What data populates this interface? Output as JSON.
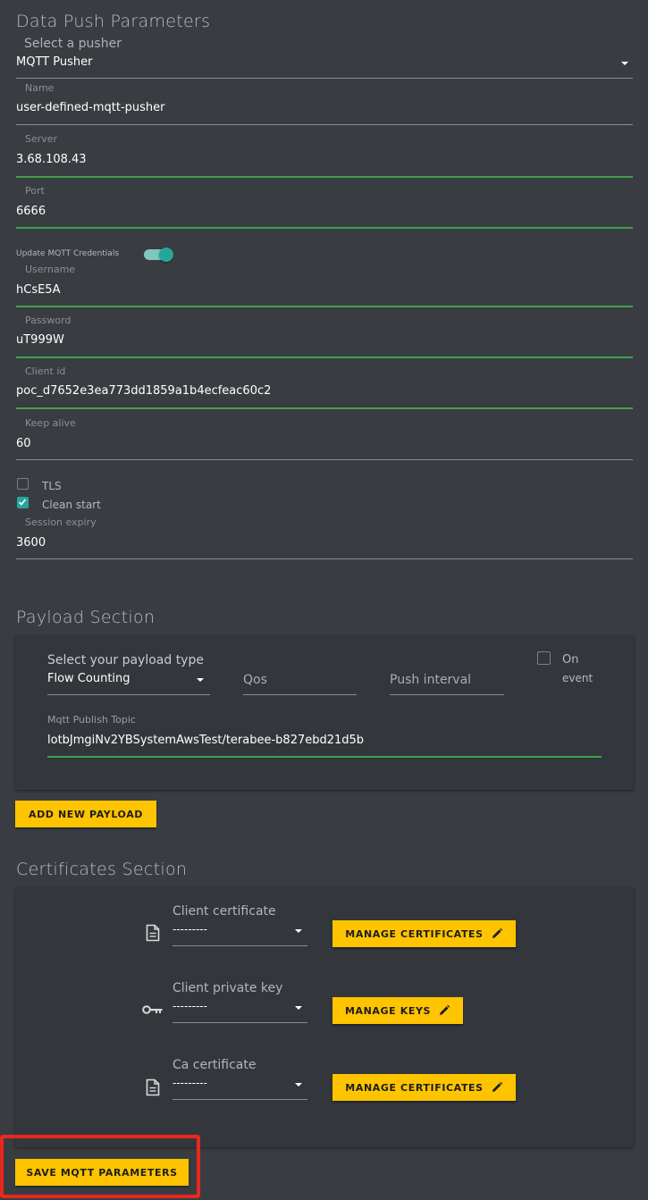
{
  "pusher_section": {
    "title": "Data Push Parameters",
    "pusher_select": {
      "label": "Select a pusher",
      "value": "MQTT Pusher"
    },
    "name": {
      "label": "Name",
      "value": "user-defined-mqtt-pusher"
    },
    "server": {
      "label": "Server",
      "value": "3.68.108.43"
    },
    "port": {
      "label": "Port",
      "value": "6666"
    },
    "update_credentials": {
      "label": "Update MQTT Credentials",
      "enabled": true
    },
    "username": {
      "label": "Username",
      "value": "hCsE5A"
    },
    "password": {
      "label": "Password",
      "value": "uT999W"
    },
    "client_id": {
      "label": "Client id",
      "value": "poc_d7652e3ea773dd1859a1b4ecfeac60c2"
    },
    "keep_alive": {
      "label": "Keep alive",
      "value": "60"
    },
    "tls": {
      "label": "TLS",
      "checked": false
    },
    "clean_start": {
      "label": "Clean start",
      "checked": true
    },
    "session_expiry": {
      "label": "Session expiry",
      "value": "3600"
    }
  },
  "payload_section": {
    "title": "Payload Section",
    "payload_type": {
      "label": "Select your payload type",
      "value": "Flow Counting"
    },
    "qos": {
      "placeholder": "Qos"
    },
    "push_interval": {
      "placeholder": "Push interval"
    },
    "on_event": {
      "label_line1": "On",
      "label_line2": "event",
      "checked": false
    },
    "publish_topic": {
      "label": "Mqtt Publish Topic",
      "value": "lotbJmgiNv2YBSystemAwsTest/terabee-b827ebd21d5b"
    },
    "add_button": "ADD NEW PAYLOAD"
  },
  "certificates_section": {
    "title": "Certificates Section",
    "rows": [
      {
        "icon": "document-icon",
        "label": "Client certificate",
        "value": "---------",
        "button": "MANAGE CERTIFICATES"
      },
      {
        "icon": "key-icon",
        "label": "Client private key",
        "value": "---------",
        "button": "MANAGE KEYS"
      },
      {
        "icon": "document-icon",
        "label": "Ca certificate",
        "value": "---------",
        "button": "MANAGE CERTIFICATES"
      }
    ]
  },
  "save_button": "SAVE MQTT PARAMETERS",
  "colors": {
    "background": "#393d42",
    "card": "#33373b",
    "accent_yellow": "#ffc400",
    "focus_green": "#3ea24a",
    "toggle_teal": "#26a69a",
    "highlight_red": "#e8281e"
  }
}
